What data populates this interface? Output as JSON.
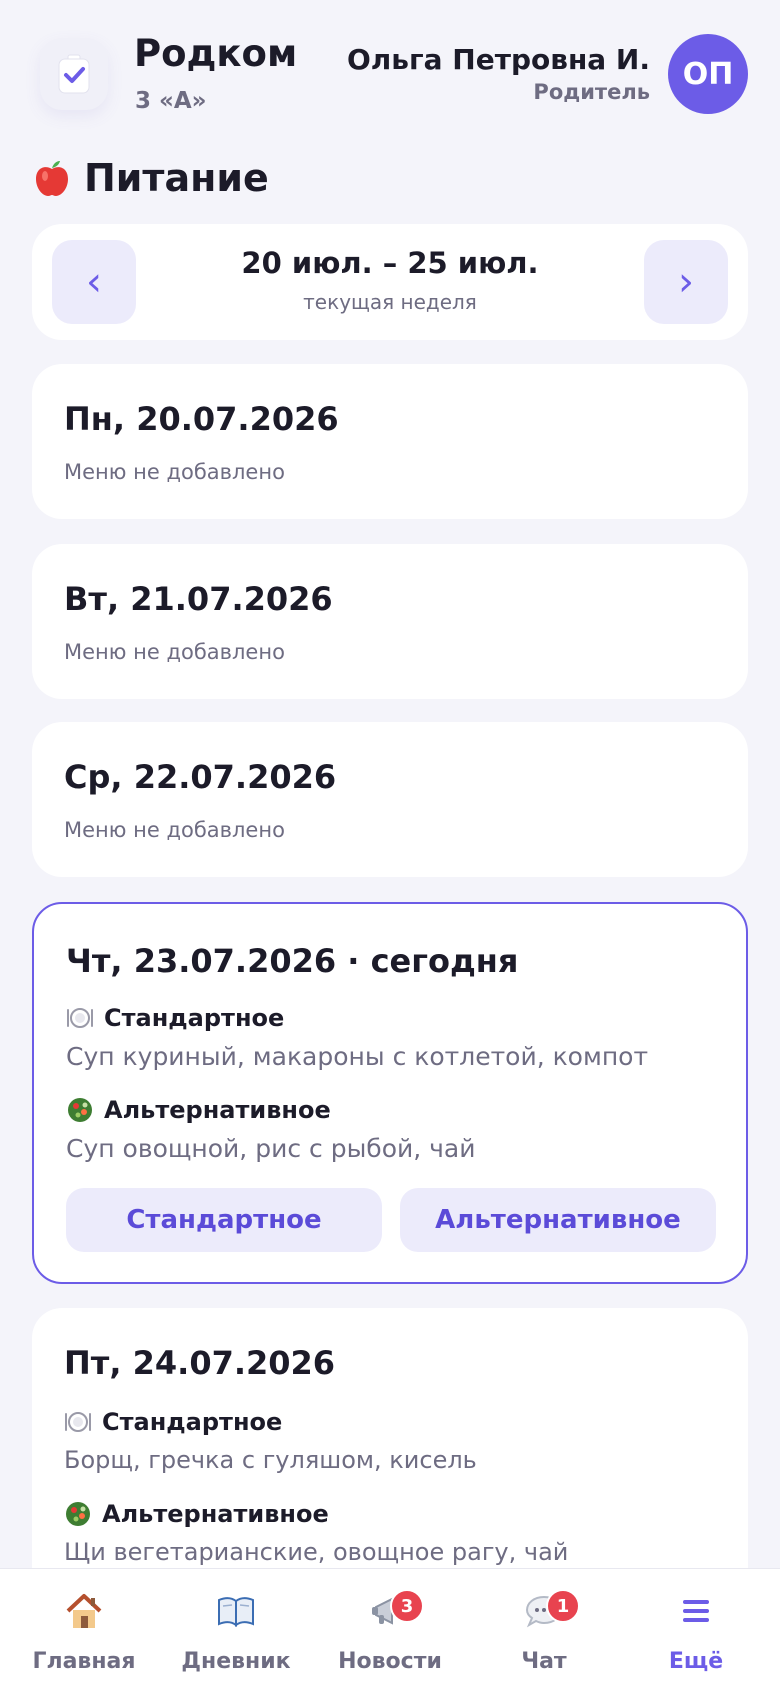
{
  "header": {
    "app_title": "Родком",
    "class_name": "3 «А»",
    "user_name": "Ольга Петровна И.",
    "user_role": "Родитель",
    "avatar_initials": "ОП"
  },
  "page": {
    "title": "Питание",
    "title_icon": "apple-icon"
  },
  "week_nav": {
    "range": "20 июл. – 25 июл.",
    "subtitle": "текущая неделя",
    "prev_label": "‹",
    "next_label": "›"
  },
  "days": [
    {
      "date": "Пн, 20.07.2026",
      "note": "Меню не добавлено"
    },
    {
      "date": "Вт, 21.07.2026",
      "note": "Меню не добавлено"
    },
    {
      "date": "Ср, 22.07.2026",
      "note": "Меню не добавлено"
    },
    {
      "date": "Чт, 23.07.2026 · сегодня",
      "today": true,
      "standard_label": "Стандартное",
      "standard_menu": "Суп куриный, макароны с котлетой, компот",
      "alt_label": "Альтернативное",
      "alt_menu": "Суп овощной, рис с рыбой, чай",
      "choose_standard": "Стандартное",
      "choose_alt": "Альтернативное"
    },
    {
      "date": "Пт, 24.07.2026",
      "standard_label": "Стандартное",
      "standard_menu": "Борщ, гречка с гуляшом, кисель",
      "alt_label": "Альтернативное",
      "alt_menu": "Щи вегетарианские, овощное рагу, чай"
    }
  ],
  "bottom_nav": [
    {
      "label": "Главная",
      "icon": "house-icon"
    },
    {
      "label": "Дневник",
      "icon": "book-icon"
    },
    {
      "label": "Новости",
      "icon": "megaphone-icon",
      "badge": "3"
    },
    {
      "label": "Чат",
      "icon": "chat-icon",
      "badge": "1"
    },
    {
      "label": "Ещё",
      "icon": "menu-icon",
      "active": true
    }
  ],
  "colors": {
    "accent": "#6c5ce7",
    "background": "#f4f4fa",
    "badge": "#e8434f"
  }
}
